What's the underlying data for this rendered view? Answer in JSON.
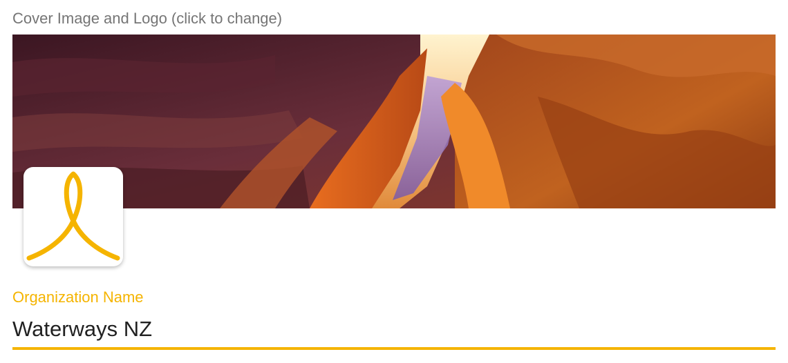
{
  "cover": {
    "label": "Cover Image and Logo (click to change)"
  },
  "icons": {
    "cover_image": "canyon-cover-image",
    "logo": "ribbon-logo-icon"
  },
  "colors": {
    "accent": "#f5b400",
    "label_gray": "#757575",
    "text": "#212121"
  },
  "organization": {
    "label": "Organization Name",
    "value": "Waterways NZ"
  }
}
